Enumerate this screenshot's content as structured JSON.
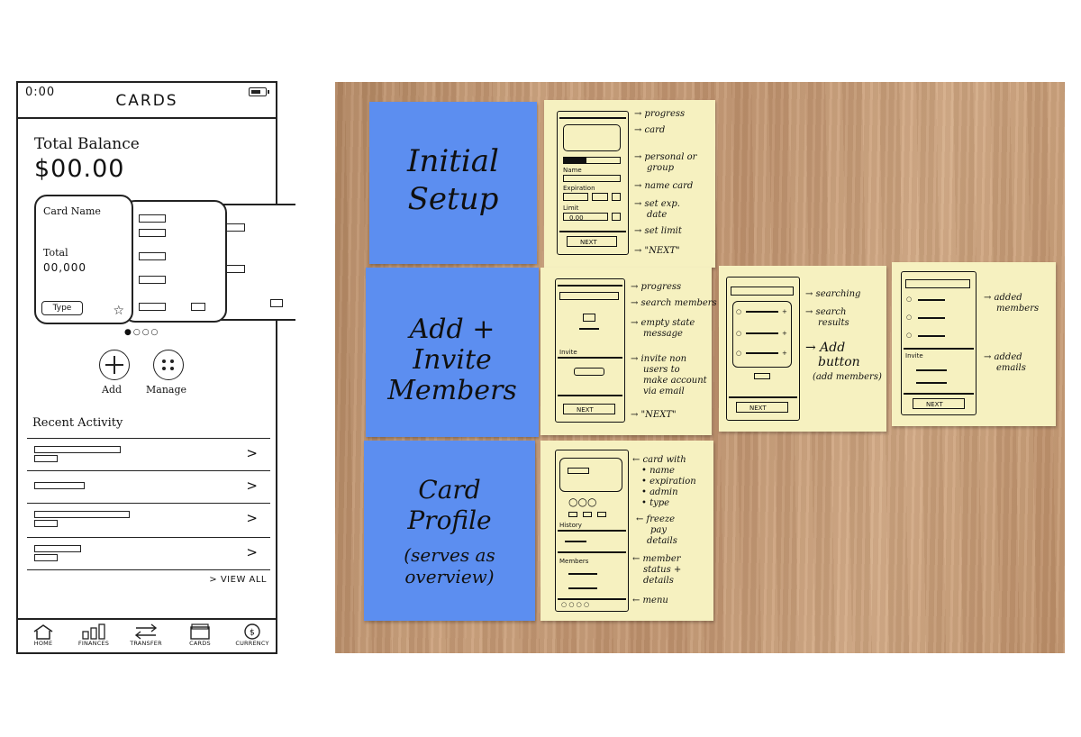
{
  "phone": {
    "status_time": "0:00",
    "title": "CARDS",
    "balance_label": "Total Balance",
    "balance_value": "$00.00",
    "card": {
      "name": "Card Name",
      "total_label": "Total",
      "total_value": "00,000",
      "type_label": "Type"
    },
    "actions": {
      "add": "Add",
      "manage": "Manage"
    },
    "recent_label": "Recent Activity",
    "view_all": "> VIEW ALL",
    "tabs": [
      {
        "label": "HOME",
        "icon": "home-icon"
      },
      {
        "label": "FINANCES",
        "icon": "bar-chart-icon"
      },
      {
        "label": "TRANSFER",
        "icon": "transfer-arrows-icon"
      },
      {
        "label": "CARDS",
        "icon": "cards-stack-icon"
      },
      {
        "label": "CURRENCY",
        "icon": "currency-coin-icon"
      }
    ]
  },
  "board": {
    "sections": [
      {
        "title_lines": [
          "Initial",
          "Setup"
        ]
      },
      {
        "title_lines": [
          "Add +",
          "Invite",
          "Members"
        ]
      },
      {
        "title_lines": [
          "Card",
          "Profile",
          "(serves as",
          "overview)"
        ]
      }
    ],
    "setup_sketch": {
      "name": "Name",
      "expiration": "Expiration",
      "limit": "Limit",
      "limit_value": "0.00",
      "next": "NEXT"
    },
    "setup_annotations": [
      "→ progress",
      "→ card",
      "→ personal or",
      "group",
      "→ name card",
      "→ set exp.",
      "date",
      "→ set limit",
      "→ \"NEXT\""
    ],
    "invite_sketch": {
      "invite": "Invite",
      "next": "NEXT"
    },
    "invite_annotations": [
      "→ progress",
      "→ search members",
      "→ empty state",
      "message",
      "→ invite non",
      "users to",
      "make account",
      "via email",
      "→ \"NEXT\""
    ],
    "search_sketch": {
      "next": "NEXT"
    },
    "search_annotations": [
      "→ searching",
      "→ search",
      "results",
      "→ Add",
      "button",
      "(add members)"
    ],
    "added_sketch": {
      "invite": "Invite",
      "next": "NEXT"
    },
    "added_annotations": [
      "→ added",
      "members",
      "→ added",
      "emails"
    ],
    "profile_sketch": {
      "history": "History",
      "members": "Members"
    },
    "profile_annotations": [
      "← card with",
      "• name",
      "• expiration",
      "• admin",
      "• type",
      "← freeze",
      "pay",
      "details",
      "← member",
      "status +",
      "details",
      "← menu"
    ]
  }
}
